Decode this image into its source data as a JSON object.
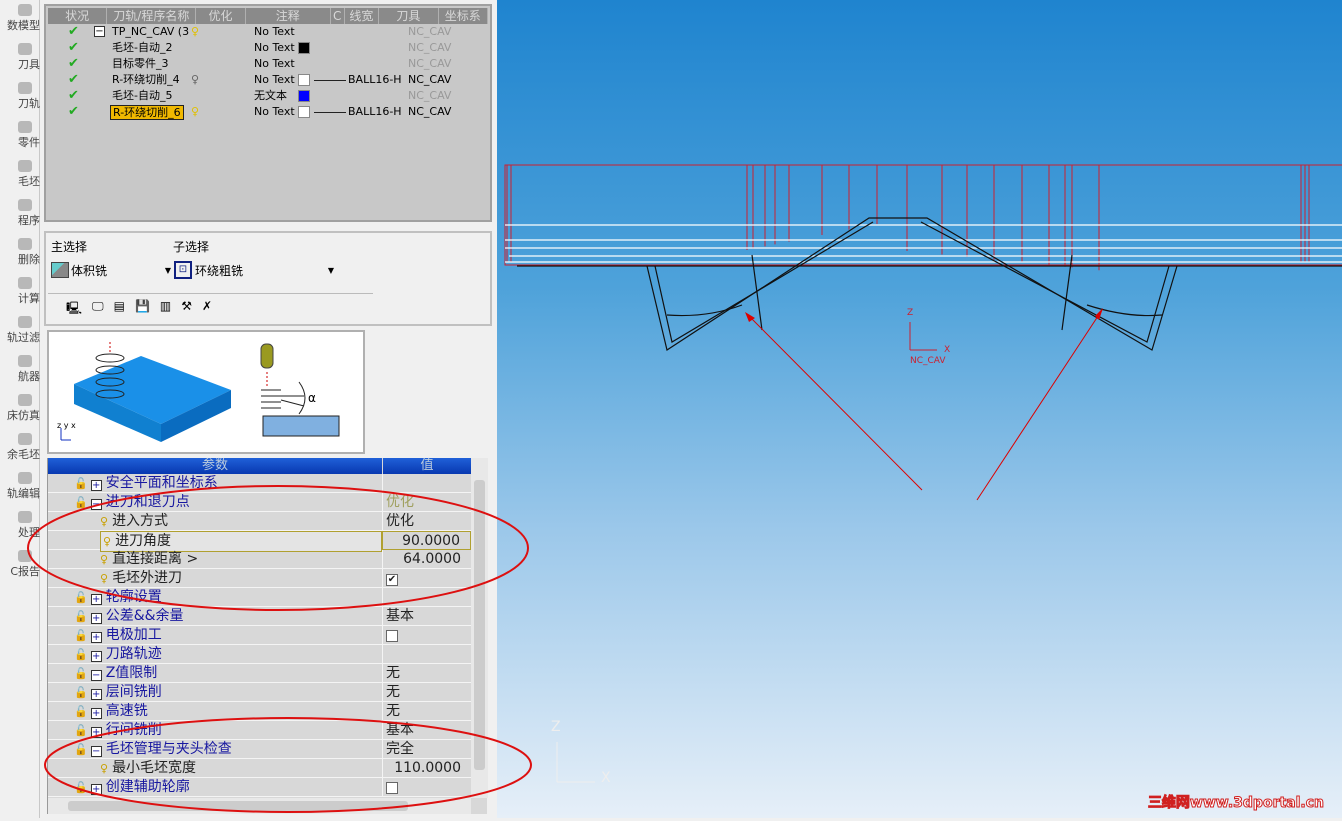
{
  "sidebar": {
    "items": [
      "数模型",
      "刀具",
      "刀轨",
      "零件",
      "毛坯",
      "程序",
      "删除",
      "计算",
      "轨过滤",
      "航器",
      "床仿真",
      "余毛坯",
      "轨编辑",
      "处理",
      "C报告"
    ]
  },
  "tree": {
    "columns": [
      "状况",
      "刀轨/程序名称",
      "优化",
      "注释",
      "C",
      "线宽",
      "刀具",
      "坐标系"
    ],
    "rows": [
      {
        "name": "TP_NC_CAV (3",
        "note": "No Text",
        "color": "",
        "tool": "",
        "cs": "NC_CAV",
        "cs_active": false,
        "bulb": "yellow",
        "expand": "−"
      },
      {
        "name": "毛坯-自动_2",
        "note": "No Text",
        "color": "#000000",
        "tool": "",
        "cs": "NC_CAV",
        "cs_active": false,
        "bulb": ""
      },
      {
        "name": "目标零件_3",
        "note": "No Text",
        "color": "",
        "tool": "",
        "cs": "NC_CAV",
        "cs_active": false,
        "bulb": ""
      },
      {
        "name": "R-环绕切削_4",
        "note": "No Text",
        "color": "#ffffff",
        "tool": "BALL16-H",
        "cs": "NC_CAV",
        "cs_active": true,
        "bulb": "gray"
      },
      {
        "name": "毛坯-自动_5",
        "note": "无文本",
        "color": "#0000ff",
        "tool": "",
        "cs": "NC_CAV",
        "cs_active": false,
        "bulb": ""
      },
      {
        "name": "R-环绕切削_6",
        "note": "No Text",
        "color": "#ffffff",
        "tool": "BALL16-H",
        "cs": "NC_CAV",
        "cs_active": true,
        "bulb": "yellow",
        "selected": true
      }
    ]
  },
  "options": {
    "main_label": "主选择",
    "main_value": "体积铣",
    "sub_label": "子选择",
    "sub_value": "环绕粗铣"
  },
  "preview": {
    "axes": "z y x",
    "alpha": "α"
  },
  "params": {
    "header_param": "参数",
    "header_value": "值",
    "rows": [
      {
        "name": "安全平面和坐标系",
        "value": "",
        "type": "group",
        "exp": "+"
      },
      {
        "name": "进刀和退刀点",
        "value": "优化",
        "type": "group",
        "exp": "−",
        "dim": true
      },
      {
        "name": "进入方式",
        "value": "优化",
        "type": "item"
      },
      {
        "name": "进刀角度",
        "value": "90.0000",
        "type": "num",
        "fx": "ƒ",
        "hl": true
      },
      {
        "name": "直连接距离 >",
        "value": "64.0000",
        "type": "num",
        "fx": "ƒ",
        "fxgreen": true
      },
      {
        "name": "毛坯外进刀",
        "value": "✔",
        "type": "check"
      },
      {
        "name": "轮廓设置",
        "value": "",
        "type": "group",
        "exp": "+"
      },
      {
        "name": "公差&&余量",
        "value": "基本",
        "type": "group",
        "exp": "+"
      },
      {
        "name": "电极加工",
        "value": "",
        "type": "groupcheck",
        "exp": "+"
      },
      {
        "name": "刀路轨迹",
        "value": "",
        "type": "group",
        "exp": "+"
      },
      {
        "name": "Z值限制",
        "value": "无",
        "type": "group",
        "exp": "−"
      },
      {
        "name": "层间铣削",
        "value": "无",
        "type": "group",
        "exp": "+"
      },
      {
        "name": "高速铣",
        "value": "无",
        "type": "group",
        "exp": "+"
      },
      {
        "name": "行间铣削",
        "value": "基本",
        "type": "group",
        "exp": "+"
      },
      {
        "name": "毛坯管理与夹头检查",
        "value": "完全",
        "type": "group",
        "exp": "−"
      },
      {
        "name": "最小毛坯宽度",
        "value": "110.0000",
        "type": "num",
        "fx": "ƒ"
      },
      {
        "name": "创建辅助轮廓",
        "value": "",
        "type": "groupcheck",
        "exp": "+"
      }
    ]
  },
  "viewport": {
    "cs_label": "NC_CAV",
    "z": "Z",
    "x": "X",
    "wcs_z": "Z",
    "wcs_x": "X",
    "watermark": "三维网www.3dportal.cn"
  },
  "colors": {
    "toolpath": "#cc2030",
    "annotation": "#dd0000",
    "accent": "#0838b0"
  }
}
